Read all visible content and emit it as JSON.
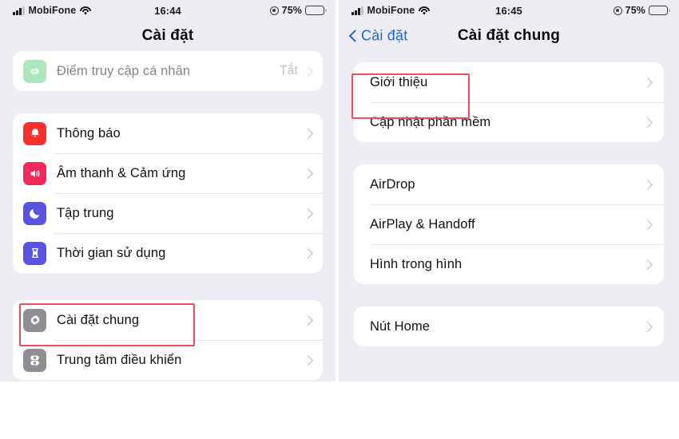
{
  "left_phone": {
    "status_bar": {
      "carrier": "MobiFone",
      "time": "16:44",
      "battery_percent": "75%",
      "signal_icon": "cellular-signal-icon",
      "wifi_icon": "wifi-icon",
      "location_icon": "location-arrow-icon",
      "battery_icon": "battery-icon"
    },
    "nav": {
      "title": "Cài đặt"
    },
    "groups": [
      {
        "rows": [
          {
            "label": "Điểm truy cập cá nhân",
            "value": "Tắt",
            "icon": "personal-hotspot-icon",
            "icon_color": "#5ed07f",
            "dim": true
          }
        ]
      },
      {
        "rows": [
          {
            "label": "Thông báo",
            "value": "",
            "icon": "notifications-bell-icon",
            "icon_color": "#fb2f2b"
          },
          {
            "label": "Âm thanh & Cảm ứng",
            "value": "",
            "icon": "sounds-haptics-speaker-icon",
            "icon_color": "#f4295b"
          },
          {
            "label": "Tập trung",
            "value": "",
            "icon": "focus-moon-icon",
            "icon_color": "#5a52e0"
          },
          {
            "label": "Thời gian sử dụng",
            "value": "",
            "icon": "screen-time-hourglass-icon",
            "icon_color": "#5a52e0"
          }
        ]
      },
      {
        "rows": [
          {
            "label": "Cài đặt chung",
            "value": "",
            "icon": "general-gear-icon",
            "icon_color": "#8e8e93"
          },
          {
            "label": "Trung tâm điều khiển",
            "value": "",
            "icon": "control-center-toggles-icon",
            "icon_color": "#8e8e93"
          }
        ]
      }
    ],
    "highlight": {
      "target": "Cài đặt chung",
      "color": "#e8505f"
    }
  },
  "right_phone": {
    "status_bar": {
      "carrier": "MobiFone",
      "time": "16:45",
      "battery_percent": "75%",
      "signal_icon": "cellular-signal-icon",
      "wifi_icon": "wifi-icon",
      "location_icon": "location-arrow-icon",
      "battery_icon": "battery-icon"
    },
    "nav": {
      "back_label": "Cài đặt",
      "title": "Cài đặt chung",
      "back_icon": "chevron-left-icon"
    },
    "groups": [
      {
        "rows": [
          {
            "label": "Giới thiệu",
            "value": ""
          },
          {
            "label": "Cập nhật phần mềm",
            "value": ""
          }
        ]
      },
      {
        "rows": [
          {
            "label": "AirDrop",
            "value": ""
          },
          {
            "label": "AirPlay & Handoff",
            "value": ""
          },
          {
            "label": "Hình trong hình",
            "value": ""
          }
        ]
      },
      {
        "rows": [
          {
            "label": "Nút Home",
            "value": ""
          }
        ]
      }
    ],
    "highlight": {
      "target": "Giới thiệu",
      "color": "#e8505f"
    }
  }
}
